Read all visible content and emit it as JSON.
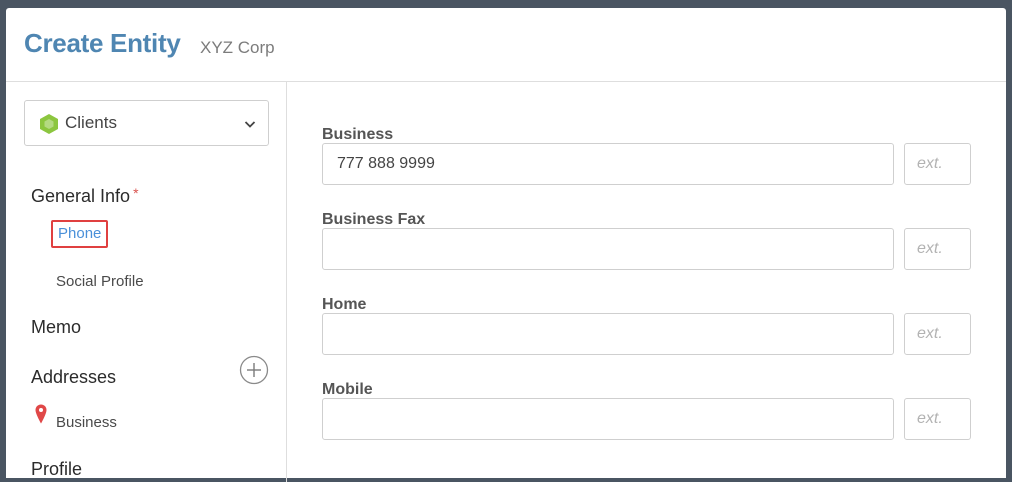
{
  "header": {
    "title": "Create Entity",
    "subtitle": "XYZ Corp"
  },
  "sidebar": {
    "entity_type": {
      "value": "Clients",
      "icon": "green-hexagon-icon",
      "accent_color": "#8cc63f"
    },
    "sections": {
      "general_info": "General Info",
      "required_marker": "*",
      "memo": "Memo",
      "addresses": "Addresses",
      "profile": "Profile"
    },
    "subsections": {
      "phone": "Phone",
      "social_profile": "Social Profile",
      "business_address": "Business"
    }
  },
  "form": {
    "business": {
      "label": "Business",
      "value": "777 888 9999",
      "ext_placeholder": "ext."
    },
    "business_fax": {
      "label": "Business Fax",
      "value": "",
      "ext_placeholder": "ext."
    },
    "home": {
      "label": "Home",
      "value": "",
      "ext_placeholder": "ext."
    },
    "mobile": {
      "label": "Mobile",
      "value": "",
      "ext_placeholder": "ext."
    }
  },
  "colors": {
    "title": "#4f86b2",
    "active_link": "#4a90d9",
    "highlight_border": "#e04040",
    "required": "#d9534f",
    "pin": "#e04848"
  }
}
